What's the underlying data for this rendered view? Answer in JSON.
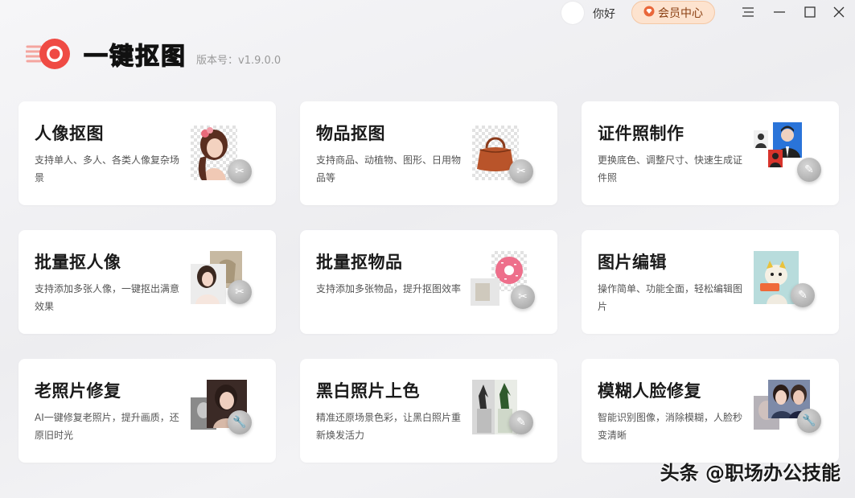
{
  "header": {
    "greeting": "你好",
    "vip_label": "会员中心",
    "colors": {
      "vip_bg": "#fde3cf",
      "vip_text": "#8a3f12",
      "logo_red": "#ef4b44"
    }
  },
  "app": {
    "title": "一键抠图",
    "version": "版本号：v1.9.0.0"
  },
  "cards": [
    {
      "title": "人像抠图",
      "desc": "支持单人、多人、各类人像复杂场景",
      "icon": "scissors-icon"
    },
    {
      "title": "物品抠图",
      "desc": "支持商品、动植物、图形、日用物品等",
      "icon": "scissors-icon"
    },
    {
      "title": "证件照制作",
      "desc": "更换底色、调整尺寸、快速生成证件照",
      "icon": "pencil-icon"
    },
    {
      "title": "批量抠人像",
      "desc": "支持添加多张人像，一键抠出满意效果",
      "icon": "scissors-icon"
    },
    {
      "title": "批量抠物品",
      "desc": "支持添加多张物品，提升抠图效率",
      "icon": "scissors-icon"
    },
    {
      "title": "图片编辑",
      "desc": "操作简单、功能全面，轻松编辑图片",
      "icon": "pencil-icon"
    },
    {
      "title": "老照片修复",
      "desc": "AI一键修复老照片，提升画质，还原旧时光",
      "icon": "wrench-icon"
    },
    {
      "title": "黑白照片上色",
      "desc": "精准还原场景色彩，让黑白照片重新焕发活力",
      "icon": "pencil-icon"
    },
    {
      "title": "模糊人脸修复",
      "desc": "智能识别图像，消除模糊，人脸秒变清晰",
      "icon": "wrench-icon"
    }
  ],
  "watermark": "头条 @职场办公技能"
}
